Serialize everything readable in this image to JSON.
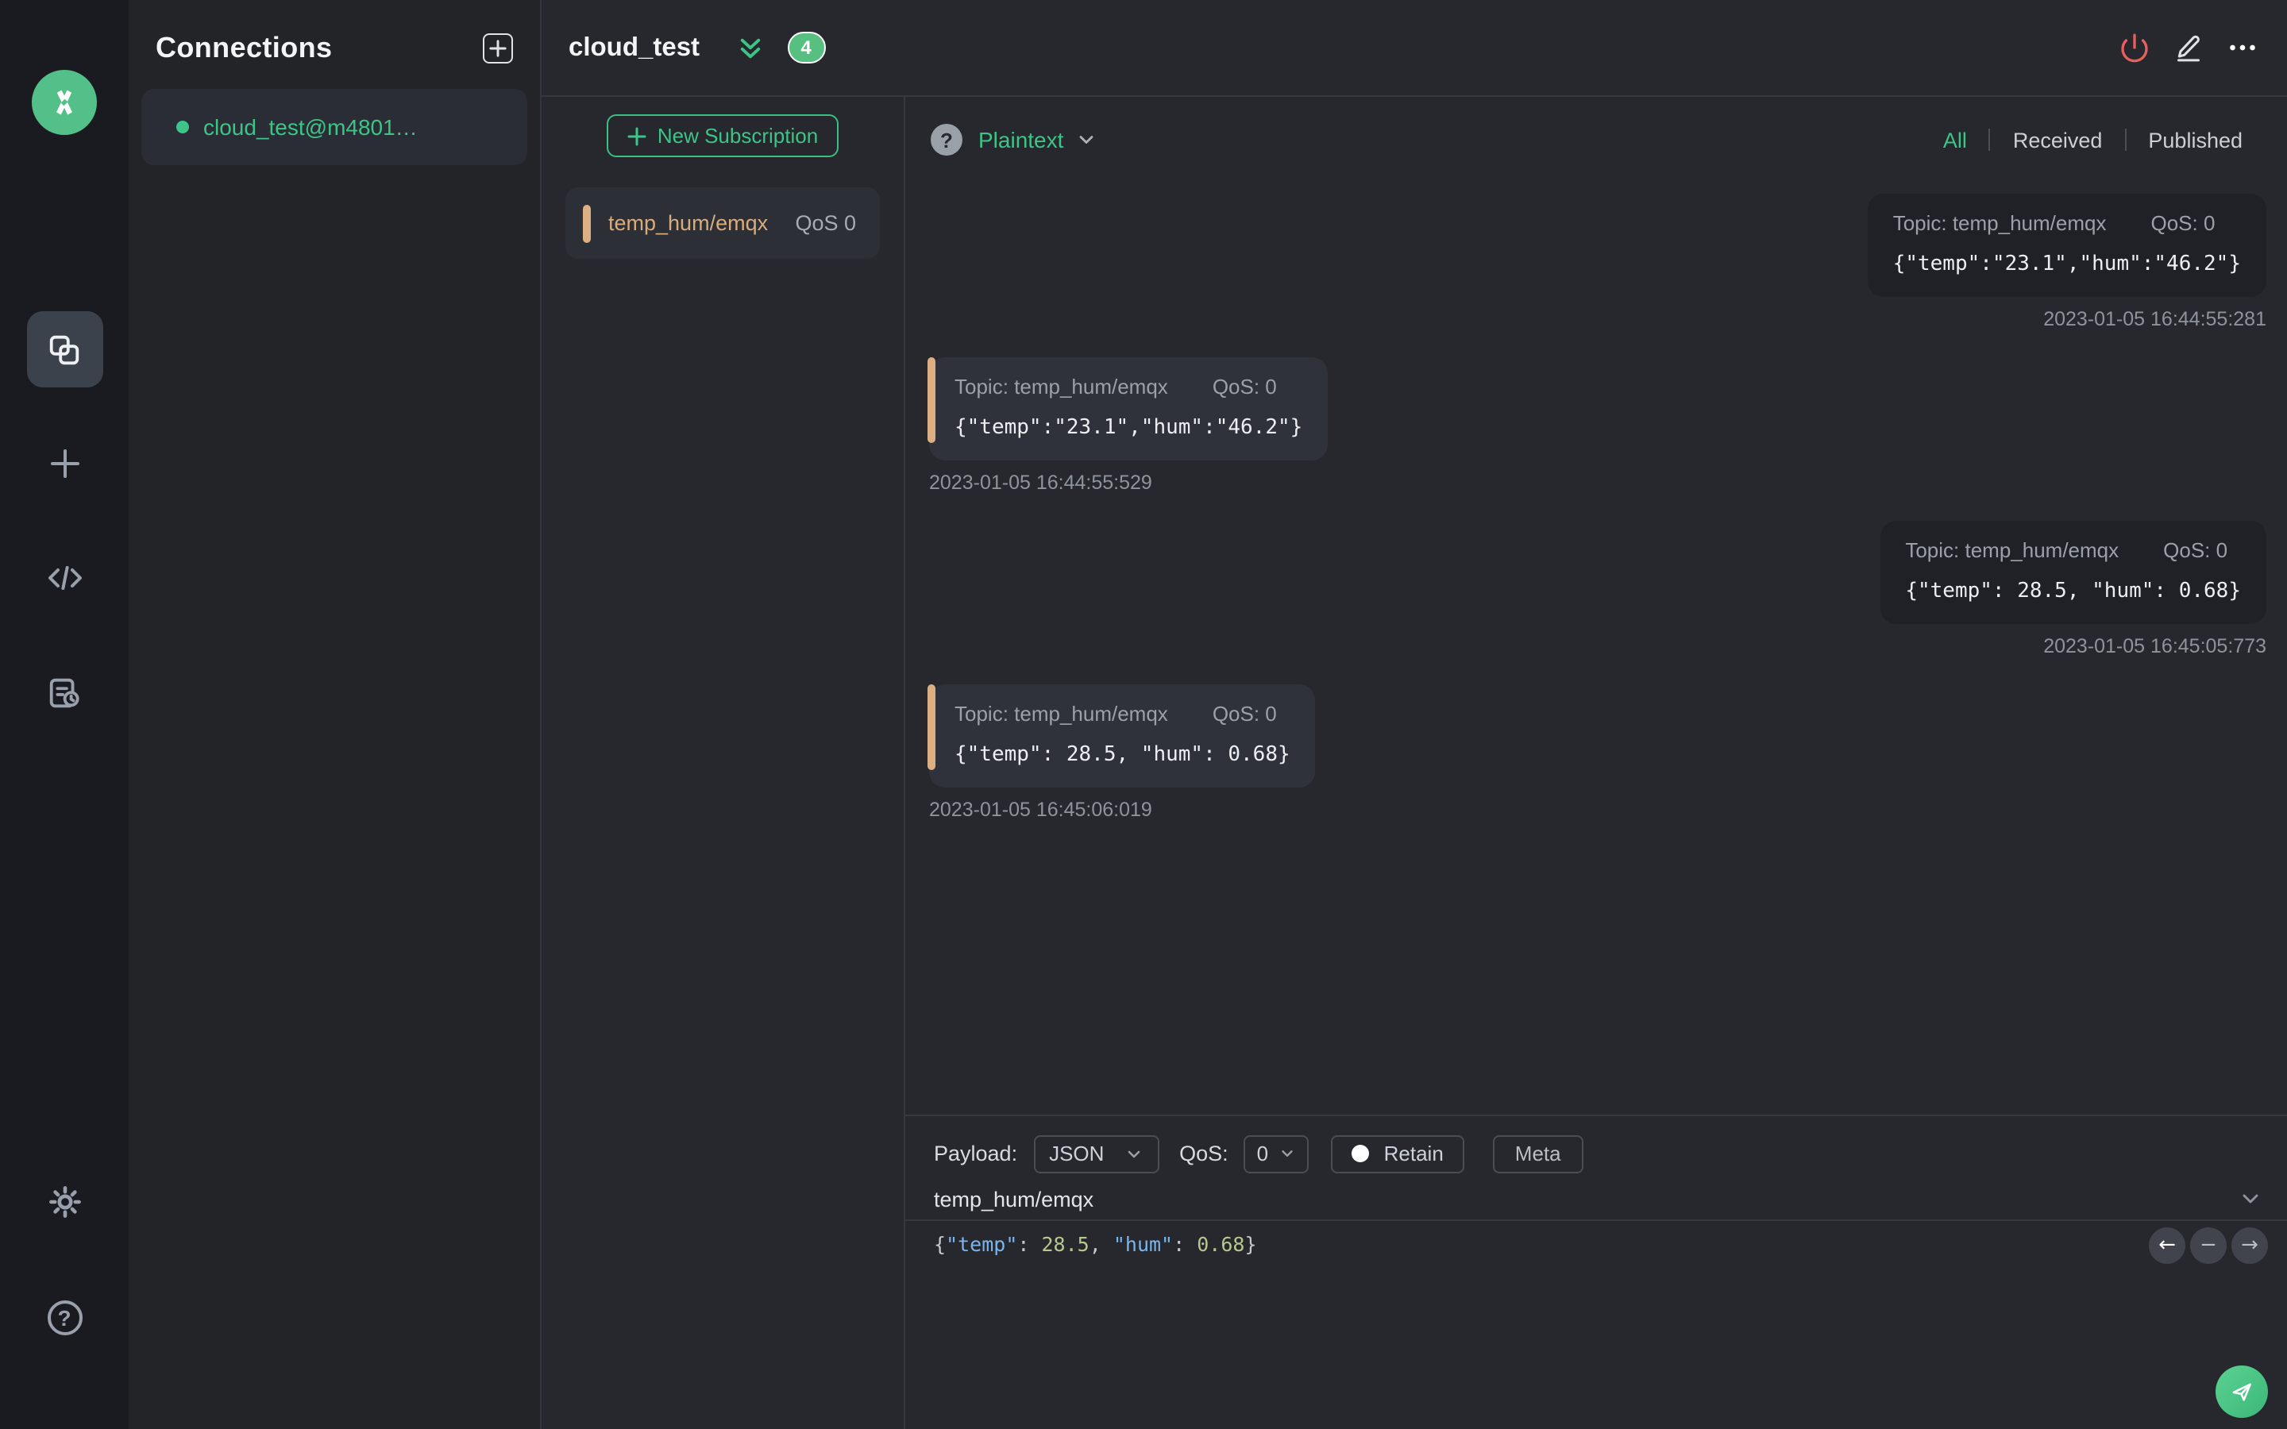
{
  "connections": {
    "title": "Connections",
    "item_label": "cloud_test@m4801…"
  },
  "header": {
    "title": "cloud_test",
    "badge_count": "4"
  },
  "subscriptions": {
    "new_label": "New Subscription",
    "item": {
      "topic": "temp_hum/emqx",
      "qos": "QoS 0"
    }
  },
  "messages": {
    "format_label": "Plaintext",
    "filters": {
      "all": "All",
      "received": "Received",
      "published": "Published"
    },
    "items": [
      {
        "side": "right",
        "topic": "Topic: temp_hum/emqx",
        "qos": "QoS: 0",
        "payload": "{\"temp\":\"23.1\",\"hum\":\"46.2\"}",
        "timestamp": "2023-01-05 16:44:55:281"
      },
      {
        "side": "left",
        "topic": "Topic: temp_hum/emqx",
        "qos": "QoS: 0",
        "payload": "{\"temp\":\"23.1\",\"hum\":\"46.2\"}",
        "timestamp": "2023-01-05 16:44:55:529"
      },
      {
        "side": "right",
        "topic": "Topic: temp_hum/emqx",
        "qos": "QoS: 0",
        "payload": "{\"temp\": 28.5, \"hum\": 0.68}",
        "timestamp": "2023-01-05 16:45:05:773"
      },
      {
        "side": "left",
        "topic": "Topic: temp_hum/emqx",
        "qos": "QoS: 0",
        "payload": "{\"temp\": 28.5, \"hum\": 0.68}",
        "timestamp": "2023-01-05 16:45:06:019"
      }
    ]
  },
  "publish": {
    "payload_label": "Payload:",
    "format_value": "JSON",
    "qos_label": "QoS:",
    "qos_value": "0",
    "retain_label": "Retain",
    "meta_label": "Meta",
    "topic_value": "temp_hum/emqx",
    "editor_tokens": {
      "open": "{",
      "key1": "\"temp\"",
      "colon1": ": ",
      "num1": "28.5",
      "comma": ", ",
      "key2": "\"hum\"",
      "colon2": ": ",
      "num2": "0.68",
      "close": "}"
    }
  },
  "colors": {
    "accent_green": "#3ec487",
    "accent_tan": "#ddb083",
    "danger_red": "#e8605c",
    "json_key_blue": "#7cb5ed",
    "json_num_green": "#b6c88b"
  }
}
